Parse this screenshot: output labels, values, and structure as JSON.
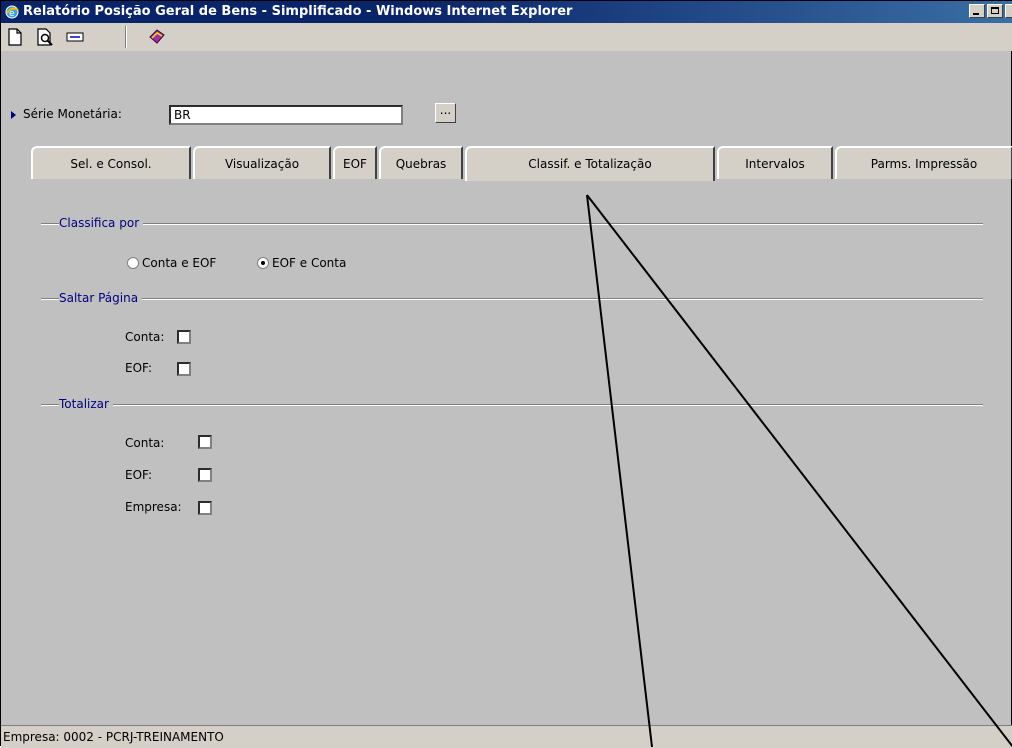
{
  "window": {
    "title": "Relatório Posição Geral de Bens - Simplificado - Windows Internet Explorer"
  },
  "toolbar": {
    "icons": [
      "new-document-icon",
      "print-preview-icon",
      "keyboard-icon",
      "book-icon"
    ]
  },
  "serie": {
    "label": "Série Monetária:",
    "value": "BR",
    "button_label": "..."
  },
  "tabs": [
    {
      "label": "Sel. e Consol."
    },
    {
      "label": "Visualização"
    },
    {
      "label": "EOF"
    },
    {
      "label": "Quebras"
    },
    {
      "label": "Classif. e Totalização",
      "active": true
    },
    {
      "label": "Intervalos"
    },
    {
      "label": "Parms. Impressão"
    }
  ],
  "classifica": {
    "title": "Classifica por",
    "options": [
      {
        "label": "Conta e EOF",
        "checked": false
      },
      {
        "label": "EOF e Conta",
        "checked": true
      }
    ]
  },
  "saltar": {
    "title": "Saltar Página",
    "fields": [
      {
        "label": "Conta:",
        "checked": false
      },
      {
        "label": "EOF:",
        "checked": false
      }
    ]
  },
  "totalizar": {
    "title": "Totalizar",
    "fields": [
      {
        "label": "Conta:",
        "checked": false
      },
      {
        "label": "EOF:",
        "checked": false
      },
      {
        "label": "Empresa:",
        "checked": false
      }
    ]
  },
  "status": {
    "text": "Empresa: 0002 - PCRJ-TREINAMENTO"
  },
  "colors": {
    "titlebar": "#0a246a",
    "group_label": "#000080",
    "background": "#c0c0c0"
  }
}
